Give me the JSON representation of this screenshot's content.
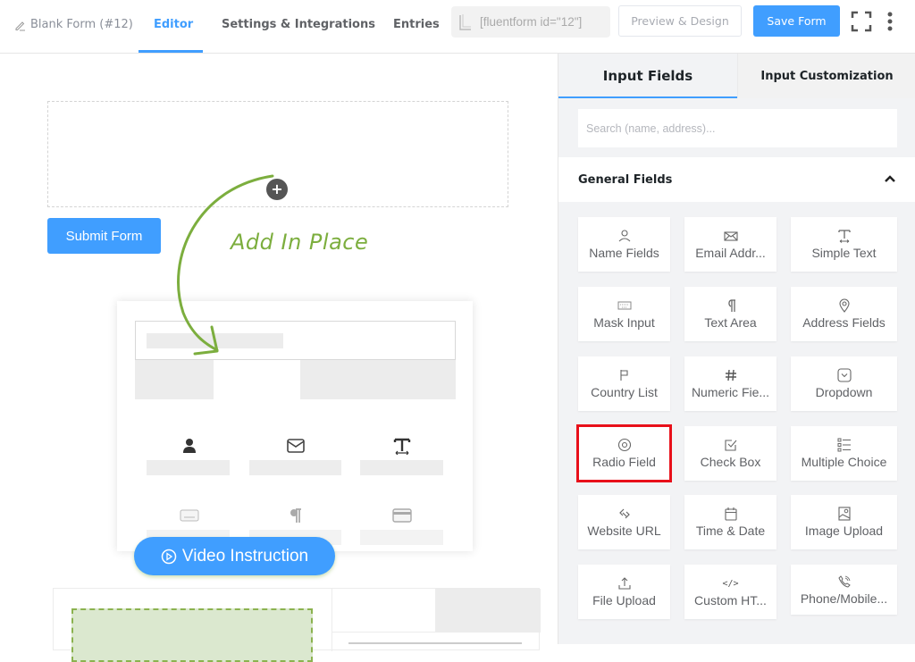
{
  "topbar": {
    "form_title": "Blank Form (#12)",
    "tabs": [
      {
        "label": "Editor",
        "active": true
      },
      {
        "label": "Settings & Integrations",
        "active": false
      },
      {
        "label": "Entries",
        "active": false
      }
    ],
    "shortcode": "[fluentform id=\"12\"]",
    "preview_label": "Preview & Design",
    "save_label": "Save Form"
  },
  "canvas": {
    "submit_label": "Submit Form",
    "hint_text": "Add In Place",
    "video_label": "Video Instruction"
  },
  "panel": {
    "tabs": [
      {
        "label": "Input Fields",
        "active": true
      },
      {
        "label": "Input Customization",
        "active": false
      }
    ],
    "search_placeholder": "Search (name, address)...",
    "section_title": "General Fields",
    "fields": [
      {
        "label": "Name Fields",
        "icon": "user-icon"
      },
      {
        "label": "Email Addr...",
        "icon": "envelope-icon"
      },
      {
        "label": "Simple Text",
        "icon": "text-icon"
      },
      {
        "label": "Mask Input",
        "icon": "keyboard-icon"
      },
      {
        "label": "Text Area",
        "icon": "paragraph-icon"
      },
      {
        "label": "Address Fields",
        "icon": "location-pin-icon"
      },
      {
        "label": "Country List",
        "icon": "flag-icon"
      },
      {
        "label": "Numeric Fie...",
        "icon": "hash-icon"
      },
      {
        "label": "Dropdown",
        "icon": "dropdown-icon"
      },
      {
        "label": "Radio Field",
        "icon": "radio-icon",
        "highlighted": true
      },
      {
        "label": "Check Box",
        "icon": "checkbox-icon"
      },
      {
        "label": "Multiple Choice",
        "icon": "list-icon"
      },
      {
        "label": "Website URL",
        "icon": "link-icon"
      },
      {
        "label": "Time & Date",
        "icon": "calendar-icon"
      },
      {
        "label": "Image Upload",
        "icon": "image-icon"
      },
      {
        "label": "File Upload",
        "icon": "upload-icon"
      },
      {
        "label": "Custom HT...",
        "icon": "code-icon"
      },
      {
        "label": "Phone/Mobile...",
        "icon": "phone-icon"
      }
    ]
  },
  "colors": {
    "accent": "#409eff",
    "hint_green": "#7cae3e",
    "highlight_red": "#e8101a"
  }
}
